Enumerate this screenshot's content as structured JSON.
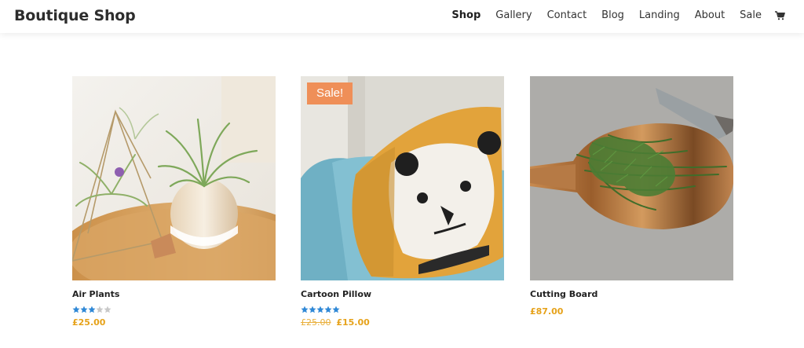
{
  "header": {
    "logo": "Boutique Shop",
    "nav": [
      "Shop",
      "Gallery",
      "Contact",
      "Blog",
      "Landing",
      "About",
      "Sale"
    ],
    "active_nav": "Shop",
    "cart_icon": "cart-icon"
  },
  "products": [
    {
      "name": "Air Plants",
      "rating": 3,
      "max_rating": 5,
      "price": "£25.00",
      "old_price": "",
      "sale_badge": ""
    },
    {
      "name": "Cartoon Pillow",
      "rating": 5,
      "max_rating": 5,
      "price": "£15.00",
      "old_price": "£25.00",
      "sale_badge": "Sale!"
    },
    {
      "name": "Cutting Board",
      "rating": 0,
      "max_rating": 5,
      "price": "£87.00",
      "old_price": "",
      "sale_badge": ""
    }
  ],
  "colors": {
    "price": "#e6a21a",
    "sale_badge": "#ef8f58",
    "star": "#2f88d6",
    "star_empty": "#c8c8c8"
  }
}
